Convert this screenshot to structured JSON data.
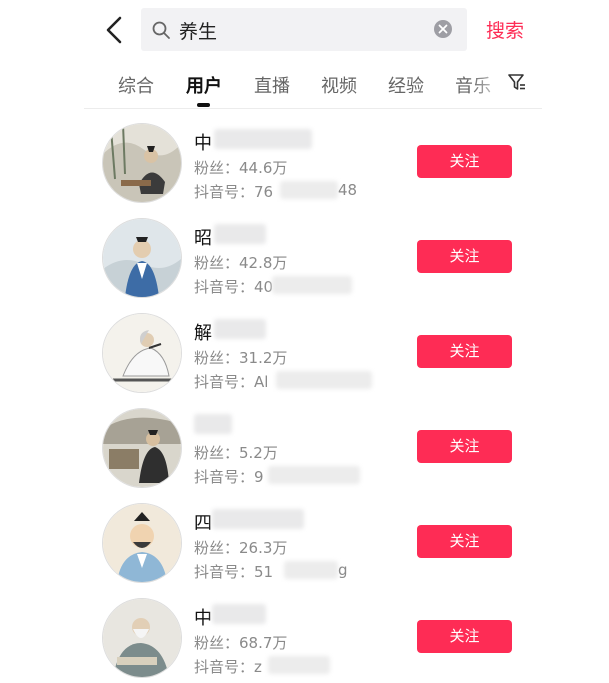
{
  "header": {
    "back_icon": "chevron-left-icon",
    "search_query": "养生",
    "search_icon": "search-icon",
    "clear_icon": "clear-circle-icon",
    "search_button": "搜索"
  },
  "tabs": [
    {
      "label": "综合",
      "active": false
    },
    {
      "label": "用户",
      "active": true
    },
    {
      "label": "直播",
      "active": false
    },
    {
      "label": "视频",
      "active": false
    },
    {
      "label": "经验",
      "active": false
    },
    {
      "label": "音乐",
      "active": false
    }
  ],
  "filter_icon": "filter-icon",
  "users": [
    {
      "name": "中",
      "fans": "粉丝：44.6万",
      "id": "抖音号：76",
      "id_tail": "48",
      "follow": "关注"
    },
    {
      "name": "昭",
      "fans": "粉丝：42.8万",
      "id": "抖音号：40",
      "id_tail": "",
      "follow": "关注"
    },
    {
      "name": "解",
      "fans": "粉丝：31.2万",
      "id": "抖音号：Al",
      "id_tail": "",
      "follow": "关注"
    },
    {
      "name": "",
      "fans": "粉丝：5.2万",
      "id": "抖音号：9",
      "id_tail": "",
      "follow": "关注"
    },
    {
      "name": "四",
      "fans": "粉丝：26.3万",
      "id": "抖音号：51",
      "id_tail": "g",
      "follow": "关注"
    },
    {
      "name": "中",
      "fans": "粉丝：68.7万",
      "id": "抖音号：z",
      "id_tail": "",
      "follow": "关注"
    }
  ],
  "colors": {
    "accent": "#fe2c55",
    "secondary_text": "#8a8a8a",
    "search_bg": "#f2f2f4"
  }
}
